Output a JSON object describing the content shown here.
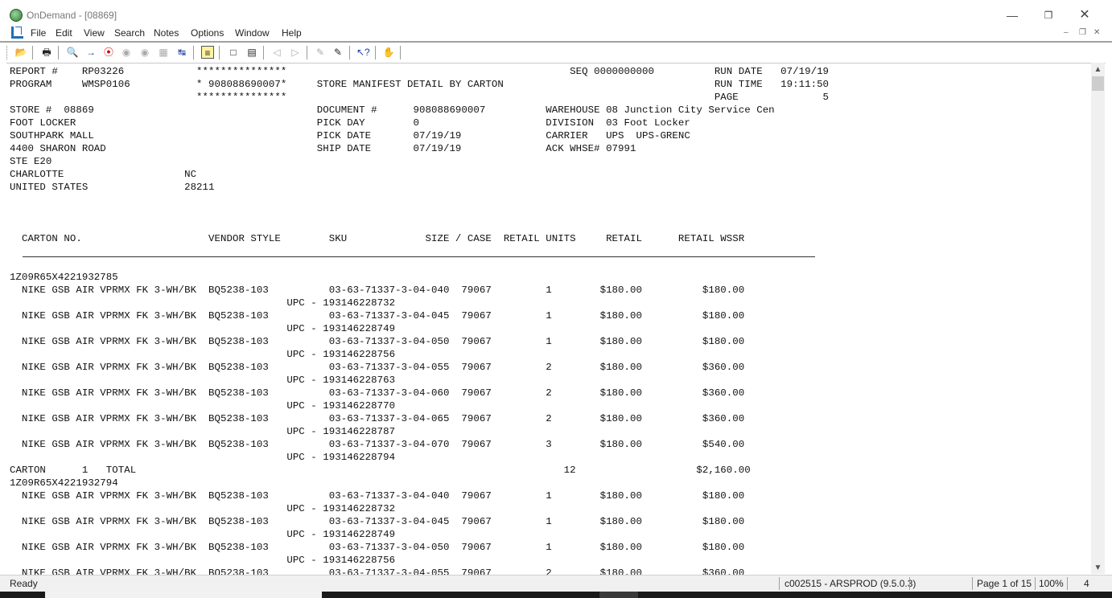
{
  "window": {
    "title": "OnDemand - [08869]",
    "app_icon": "ondemand-globe-icon"
  },
  "menu": [
    "File",
    "Edit",
    "View",
    "Search",
    "Notes",
    "Options",
    "Window",
    "Help"
  ],
  "toolbar": {
    "icons": [
      "open-folder-icon",
      "print-icon",
      "find-icon",
      "go-to-page-icon",
      "stop-icon",
      "find-next-icon",
      "find-previous-icon",
      "thumbnails-icon",
      "fit-page-icon",
      "note-icon",
      "blank-page-icon",
      "properties-icon",
      "previous-document-icon",
      "next-document-icon",
      "annotate-icon",
      "copy-annotation-icon",
      "whats-this-help-icon",
      "hand-icon"
    ]
  },
  "report": {
    "lines": [
      "REPORT #    RP03226            ***************                                               SEQ 0000000000          RUN DATE   07/19/19",
      "PROGRAM     WMSP0106           * 908088690007*     STORE MANIFEST DETAIL BY CARTON                                   RUN TIME   19:11:50",
      "                               ***************                                                                       PAGE              5",
      "STORE #  08869                                     DOCUMENT #      908088690007          WAREHOUSE 08 Junction City Service Cen",
      "FOOT LOCKER                                        PICK DAY        0                     DIVISION  03 Foot Locker",
      "SOUTHPARK MALL                                     PICK DATE       07/19/19              CARRIER   UPS  UPS-GRENC",
      "4400 SHARON ROAD                                   SHIP DATE       07/19/19              ACK WHSE# 07991",
      "STE E20",
      "CHARLOTTE                    NC",
      "UNITED STATES                28211",
      "",
      "",
      "",
      "  CARTON NO.                     VENDOR STYLE        SKU             SIZE / CASE  RETAIL UNITS     RETAIL      RETAIL WSSR",
      "",
      "",
      "1Z09R65X4221932785",
      "  NIKE GSB AIR VPRMX FK 3-WH/BK  BQ5238-103          03-63-71337-3-04-040  79067         1        $180.00          $180.00",
      "                                              UPC - 193146228732",
      "  NIKE GSB AIR VPRMX FK 3-WH/BK  BQ5238-103          03-63-71337-3-04-045  79067         1        $180.00          $180.00",
      "                                              UPC - 193146228749",
      "  NIKE GSB AIR VPRMX FK 3-WH/BK  BQ5238-103          03-63-71337-3-04-050  79067         1        $180.00          $180.00",
      "                                              UPC - 193146228756",
      "  NIKE GSB AIR VPRMX FK 3-WH/BK  BQ5238-103          03-63-71337-3-04-055  79067         2        $180.00          $360.00",
      "                                              UPC - 193146228763",
      "  NIKE GSB AIR VPRMX FK 3-WH/BK  BQ5238-103          03-63-71337-3-04-060  79067         2        $180.00          $360.00",
      "                                              UPC - 193146228770",
      "  NIKE GSB AIR VPRMX FK 3-WH/BK  BQ5238-103          03-63-71337-3-04-065  79067         2        $180.00          $360.00",
      "                                              UPC - 193146228787",
      "  NIKE GSB AIR VPRMX FK 3-WH/BK  BQ5238-103          03-63-71337-3-04-070  79067         3        $180.00          $540.00",
      "                                              UPC - 193146228794",
      "CARTON      1   TOTAL                                                                       12                    $2,160.00",
      "1Z09R65X4221932794",
      "  NIKE GSB AIR VPRMX FK 3-WH/BK  BQ5238-103          03-63-71337-3-04-040  79067         1        $180.00          $180.00",
      "                                              UPC - 193146228732",
      "  NIKE GSB AIR VPRMX FK 3-WH/BK  BQ5238-103          03-63-71337-3-04-045  79067         1        $180.00          $180.00",
      "                                              UPC - 193146228749",
      "  NIKE GSB AIR VPRMX FK 3-WH/BK  BQ5238-103          03-63-71337-3-04-050  79067         1        $180.00          $180.00",
      "                                              UPC - 193146228756",
      "  NIKE GSB AIR VPRMX FK 3-WH/BK  BQ5238-103          03-63-71337-3-04-055  79067         2        $180.00          $360.00"
    ]
  },
  "status": {
    "ready": "Ready",
    "server": "c002515 - ARSPROD (9.5.0.3)",
    "page": "Page 1 of 15",
    "zoom": "100%",
    "count": "4"
  }
}
